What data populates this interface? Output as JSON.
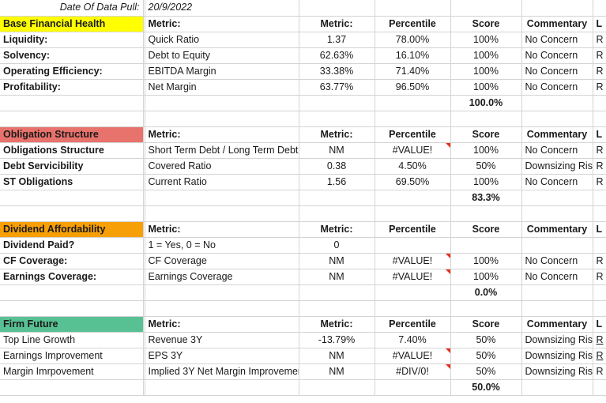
{
  "meta": {
    "date_label": "Date Of Data Pull:",
    "date_value": "20/9/2022"
  },
  "columns": {
    "metric": "Metric:",
    "value": "Metric:",
    "percentile": "Percentile",
    "score": "Score",
    "commentary": "Commentary",
    "last_cut": "L"
  },
  "colors": {
    "base_financial_health": "#FFFF00",
    "obligation_structure": "#E8726C",
    "dividend_affordability": "#F79F06",
    "firm_future": "#58C193",
    "comment_marker": "#E8301C",
    "link": "#1155CC",
    "gridline": "#d4d4d4"
  },
  "sections": [
    {
      "id": "base-financial-health",
      "title": "Base Financial Health",
      "color_class": "hdr-yellow",
      "label_bold": true,
      "rows": [
        {
          "label": "Liquidity:",
          "metric": "Quick Ratio",
          "value": "1.37",
          "percentile": "78.00%",
          "percentile_comment": false,
          "score": "100%",
          "commentary": "No Concern",
          "last_cut": "R",
          "last_link": false
        },
        {
          "label": "Solvency:",
          "metric": "Debt to Equity",
          "value": "62.63%",
          "percentile": "16.10%",
          "percentile_comment": false,
          "score": "100%",
          "commentary": "No Concern",
          "last_cut": "R",
          "last_link": false
        },
        {
          "label": "Operating Efficiency:",
          "metric": "EBITDA Margin",
          "value": "33.38%",
          "percentile": "71.40%",
          "percentile_comment": false,
          "score": "100%",
          "commentary": "No Concern",
          "last_cut": "R",
          "last_link": false
        },
        {
          "label": "Profitability:",
          "metric": "Net Margin",
          "value": "63.77%",
          "percentile": "96.50%",
          "percentile_comment": false,
          "score": "100%",
          "commentary": "No Concern",
          "last_cut": "R",
          "last_link": false
        }
      ],
      "total": "100.0%"
    },
    {
      "id": "obligation-structure",
      "title": "Obligation Structure",
      "color_class": "hdr-salmon",
      "label_bold": true,
      "rows": [
        {
          "label": "Obligations Structure",
          "metric": "Short Term Debt / Long Term Debt",
          "value": "NM",
          "percentile": "#VALUE!",
          "percentile_comment": true,
          "score": "100%",
          "commentary": "No Concern",
          "last_cut": "R",
          "last_link": false
        },
        {
          "label": "Debt Servicibility",
          "metric": "Covered Ratio",
          "value": "0.38",
          "percentile": "4.50%",
          "percentile_comment": false,
          "score": "50%",
          "commentary": "Downsizing Risk",
          "last_cut": "R",
          "last_link": false
        },
        {
          "label": "ST Obligations",
          "metric": "Current Ratio",
          "value": "1.56",
          "percentile": "69.50%",
          "percentile_comment": false,
          "score": "100%",
          "commentary": "No Concern",
          "last_cut": "R",
          "last_link": false
        }
      ],
      "total": "83.3%"
    },
    {
      "id": "dividend-affordability",
      "title": "Dividend Affordability",
      "color_class": "hdr-orange",
      "label_bold": true,
      "rows": [
        {
          "label": "Dividend Paid?",
          "metric": "1 = Yes, 0 = No",
          "value": "0",
          "percentile": "",
          "percentile_comment": false,
          "score": "",
          "commentary": "",
          "last_cut": "",
          "last_link": false
        },
        {
          "label": "CF Coverage:",
          "metric": "CF Coverage",
          "value": "NM",
          "percentile": "#VALUE!",
          "percentile_comment": true,
          "score": "100%",
          "commentary": "No Concern",
          "last_cut": "R",
          "last_link": false
        },
        {
          "label": "Earnings Coverage:",
          "metric": "Earnings Coverage",
          "value": "NM",
          "percentile": "#VALUE!",
          "percentile_comment": true,
          "score": "100%",
          "commentary": "No Concern",
          "last_cut": "R",
          "last_link": false
        }
      ],
      "total": "0.0%"
    },
    {
      "id": "firm-future",
      "title": "Firm Future",
      "color_class": "hdr-green",
      "label_bold": false,
      "rows": [
        {
          "label": "Top Line Growth",
          "metric": "Revenue 3Y",
          "value": "-13.79%",
          "percentile": "7.40%",
          "percentile_comment": false,
          "score": "50%",
          "commentary": "Downsizing Risk",
          "last_cut": "R",
          "last_link": true
        },
        {
          "label": "Earnings Improvement",
          "metric": "EPS 3Y",
          "value": "NM",
          "percentile": "#VALUE!",
          "percentile_comment": true,
          "score": "50%",
          "commentary": "Downsizing Risk",
          "last_cut": "R",
          "last_link": true
        },
        {
          "label": "Margin Imrpovement",
          "metric": "Implied 3Y Net Margin Improvemen",
          "value": "NM",
          "percentile": "#DIV/0!",
          "percentile_comment": true,
          "score": "50%",
          "commentary": "Downsizing Risk",
          "last_cut": "R",
          "last_link": false
        }
      ],
      "total": "50.0%"
    }
  ]
}
